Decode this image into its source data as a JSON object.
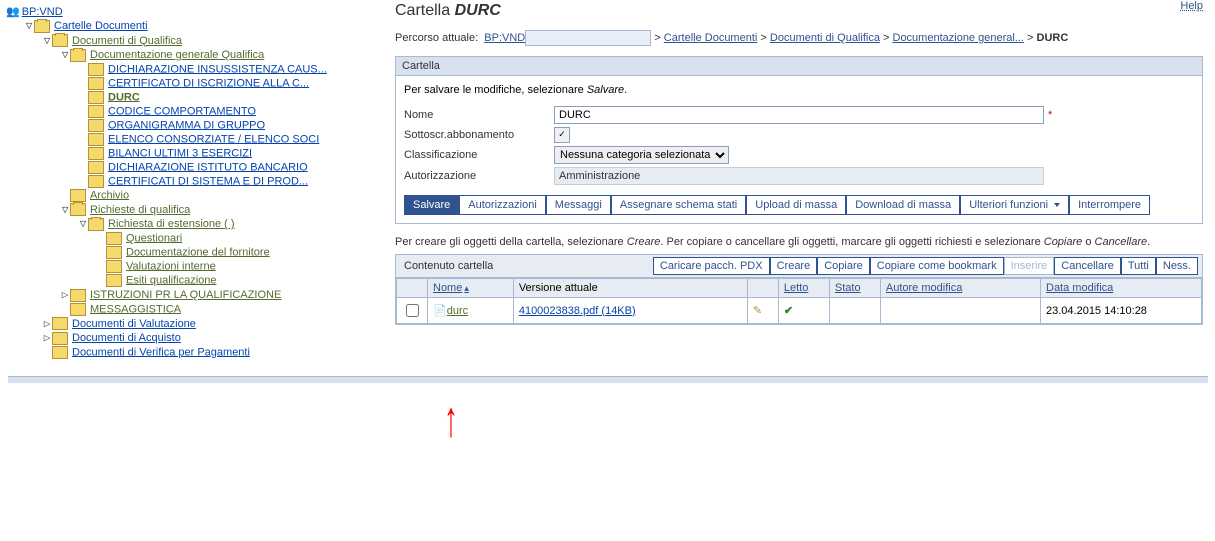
{
  "help_label": "Help",
  "root_label": "BP:VND",
  "tree": {
    "cartelle": "Cartelle Documenti",
    "qualifica": "Documenti di Qualifica",
    "doc_gen": "Documentazione generale Qualifica",
    "dich_insus": "DICHIARAZIONE INSUSSISTENZA CAUS...",
    "cert_iscr": "CERTIFICATO DI ISCRIZIONE ALLA C...",
    "durc": "DURC",
    "codice": "CODICE COMPORTAMENTO",
    "organigramma": "ORGANIGRAMMA DI GRUPPO",
    "elenco": "ELENCO CONSORZIATE / ELENCO SOCI",
    "bilanci": "BILANCI ULTIMI 3 ESERCIZI",
    "dich_banc": "DICHIARAZIONE ISTITUTO BANCARIO",
    "cert_sist": "CERTIFICATI DI SISTEMA E DI PROD...",
    "archivio": "Archivio",
    "richieste": "Richieste di qualifica",
    "rich_est": "Richiesta di estensione (           )",
    "questionari": "Questionari",
    "doc_forn": "Documentazione del fornitore",
    "val_int": "Valutazioni interne",
    "esiti": "Esiti qualificazione",
    "istruzioni": "ISTRUZIONI PR LA QUALIFICAZIONE",
    "messaggistica": "MESSAGGISTICA",
    "doc_val": "Documenti di Valutazione",
    "doc_acq": "Documenti di Acquisto",
    "doc_ver": "Documenti di Verifica per Pagamenti"
  },
  "page_title_prefix": "Cartella",
  "page_title_em": "DURC",
  "breadcrumb": {
    "label": "Percorso attuale:",
    "bp": "BP:VND",
    "l1": "Cartelle Documenti",
    "l2": "Documenti di Qualifica",
    "l3": "Documentazione general...",
    "current": "DURC"
  },
  "panel": {
    "header": "Cartella",
    "save_instr_a": "Per salvare le modifiche, selezionare ",
    "save_instr_b": "Salvare",
    "nome_lbl": "Nome",
    "nome_val": "DURC",
    "sott_lbl": "Sottoscr.abbonamento",
    "class_lbl": "Classificazione",
    "class_val": "Nessuna categoria selezionata",
    "auth_lbl": "Autorizzazione",
    "auth_val": "Amministrazione"
  },
  "buttons": {
    "salvare": "Salvare",
    "autorizzazioni": "Autorizzazioni",
    "messaggi": "Messaggi",
    "assegnare": "Assegnare schema stati",
    "upload": "Upload di massa",
    "download": "Download di massa",
    "ult_funz": "Ulteriori funzioni",
    "interrompere": "Interrompere"
  },
  "sub_instr": {
    "a": "Per creare gli oggetti della cartella, selezionare ",
    "b": "Creare",
    "c": ". Per copiare o cancellare gli oggetti, marcare gli oggetti richiesti e selezionare ",
    "d": "Copiare",
    "e": " o ",
    "f": "Cancellare",
    "g": "."
  },
  "content": {
    "header": "Contenuto cartella",
    "caricare": "Caricare pacch. PDX",
    "creare": "Creare",
    "copiare": "Copiare",
    "copiare_bm": "Copiare come bookmark",
    "inserire": "Inserire",
    "cancellare": "Cancellare",
    "tutti": "Tutti",
    "ness": "Ness.",
    "col_nome": "Nome",
    "col_ver": "Versione attuale",
    "col_letto": "Letto",
    "col_stato": "Stato",
    "col_autore": "Autore modifica",
    "col_data": "Data modifica",
    "row_name": "durc",
    "row_ver": "4100023838.pdf (14KB)",
    "row_date": "23.04.2015 14:10:28"
  }
}
